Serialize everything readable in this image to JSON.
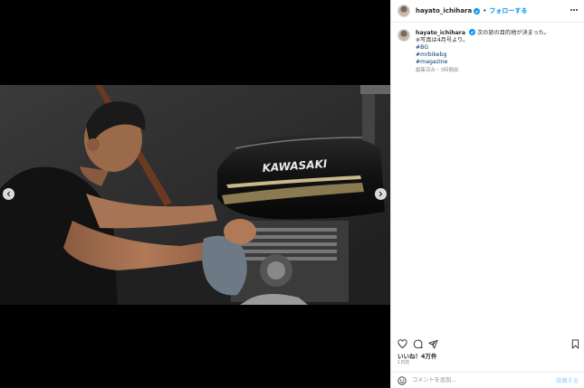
{
  "post": {
    "username": "hayato_ichihara",
    "verified": true,
    "follow_label": "フォローする",
    "separator": "•",
    "caption_line1": "次の旅の目的地が決まった。",
    "caption_line2": "※写真は4月号より。",
    "hashtags": [
      "#BG",
      "#mrbikebg",
      "#magazine"
    ],
    "caption_meta": "編集済み・3時間前",
    "likes": "いいね！4万件",
    "time_ago": "1日前",
    "comment_placeholder": "コメントを追加...",
    "post_label": "投稿する"
  },
  "photo": {
    "tank_text": "KAWASAKI"
  },
  "icons": {
    "more": "more-horizontal-icon",
    "heart": "heart-icon",
    "comment": "comment-icon",
    "share": "share-icon",
    "bookmark": "bookmark-icon",
    "emoji": "emoji-icon",
    "prev": "chevron-left-icon",
    "next": "chevron-right-icon"
  },
  "colors": {
    "link": "#0095f6",
    "hashtag": "#00376b",
    "muted": "#8e8e8e",
    "text": "#262626"
  }
}
